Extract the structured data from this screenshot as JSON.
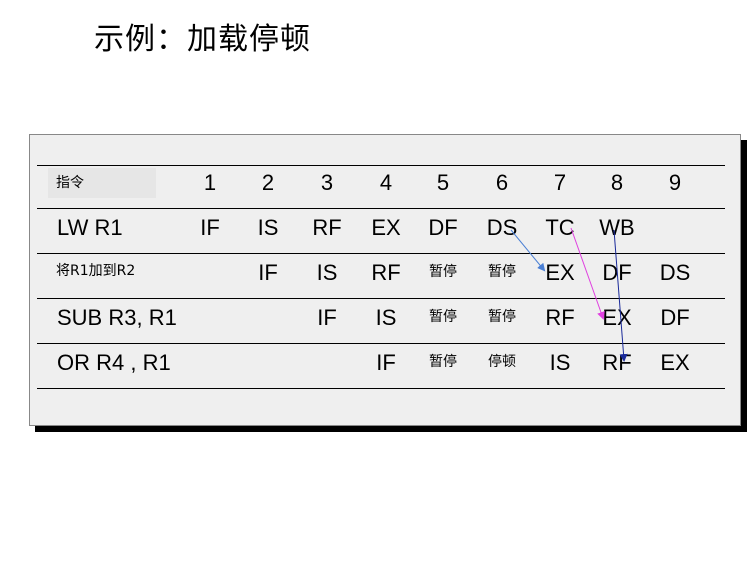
{
  "title": "示例：加载停顿",
  "table": {
    "header_label": "指令",
    "cycles": [
      "1",
      "2",
      "3",
      "4",
      "5",
      "6",
      "7",
      "8",
      "9"
    ],
    "rows": [
      {
        "label": "LW    R1",
        "cells": [
          "IF",
          "IS",
          "RF",
          "EX",
          "DF",
          "DS",
          "TC",
          "WB",
          ""
        ]
      },
      {
        "label": "将R1加到R2",
        "cells": [
          "",
          "IF",
          "IS",
          "RF",
          "暂停",
          "暂停",
          "EX",
          "DF",
          "DS"
        ]
      },
      {
        "label": "SUB R3, R1",
        "cells": [
          "",
          "",
          "IF",
          "IS",
          "暂停",
          "暂停",
          "RF",
          "EX",
          "DF"
        ]
      },
      {
        "label": "OR    R4 , R1",
        "cells": [
          "",
          "",
          "",
          "IF",
          "暂停",
          "停顿",
          "IS",
          "RF",
          "EX"
        ]
      }
    ]
  },
  "arrows": [
    {
      "from": "DS",
      "to": "EX",
      "color": "#4a7fd4"
    },
    {
      "from": "TC",
      "to": "EX",
      "color": "#e040e0"
    },
    {
      "from": "WB",
      "to": "RF",
      "color": "#1a2a9a"
    }
  ]
}
